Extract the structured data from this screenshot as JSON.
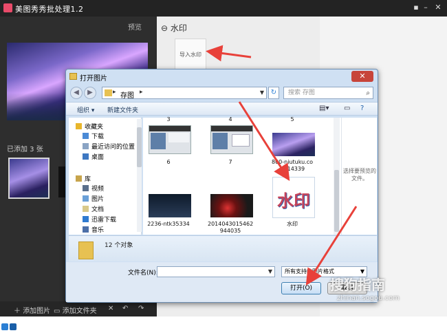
{
  "app": {
    "title": "美图秀秀批处理1.2",
    "preview_link": "预览",
    "added_count": "已添加 3 张",
    "bottom": {
      "add_image": "添加图片",
      "add_folder": "添加文件夹",
      "delete": "✕",
      "undo": "↶",
      "redo": "↷"
    },
    "right_panel": {
      "header": "水印",
      "import_button": "导入水印"
    }
  },
  "dialog": {
    "title": "打开图片",
    "close": "✕",
    "address": {
      "crumb": "存图"
    },
    "search_placeholder": "搜索 存图",
    "commands": {
      "organize": "组织 ▾",
      "new_folder": "新建文件夹"
    },
    "nav_items": [
      {
        "label": "收藏夹",
        "icon": "star-icon"
      },
      {
        "label": "下载",
        "icon": "download-icon"
      },
      {
        "label": "最近访问的位置",
        "icon": "recent-icon"
      },
      {
        "label": "桌面",
        "icon": "desktop-icon"
      },
      {
        "label": "库",
        "icon": "library-icon"
      },
      {
        "label": "视频",
        "icon": "video-icon"
      },
      {
        "label": "图片",
        "icon": "pictures-icon"
      },
      {
        "label": "文档",
        "icon": "documents-icon"
      },
      {
        "label": "迅雷下载",
        "icon": "thunder-icon"
      },
      {
        "label": "音乐",
        "icon": "music-icon"
      }
    ],
    "top_labels": [
      "3",
      "4",
      "5"
    ],
    "files": [
      {
        "name": "6"
      },
      {
        "name": "7"
      },
      {
        "name": "800-niutuku.com-14339",
        "line1": "800-niutuku.co",
        "line2": "m-14339"
      },
      {
        "name": "2236-ntk35334"
      },
      {
        "name": "2014043015462944035",
        "line1": "2014043015462",
        "line2": "944035"
      },
      {
        "name": "水印",
        "thumb_text": "水印"
      }
    ],
    "preview_message": "选择要预览的文件。",
    "details": "12 个对象",
    "filename_label": "文件名(N):",
    "filename_value": "",
    "filetype": "所有支持的图片格式",
    "open_button": "打开(O)",
    "cancel_button": "取消"
  },
  "watermark_overlay": {
    "brand": "搜狗指南",
    "url": "zhinan.sogou.com"
  },
  "colors": {
    "arrow": "#e8413a",
    "dialog_bg": "#cfe0f3",
    "app_bg": "#2b2b2b"
  }
}
